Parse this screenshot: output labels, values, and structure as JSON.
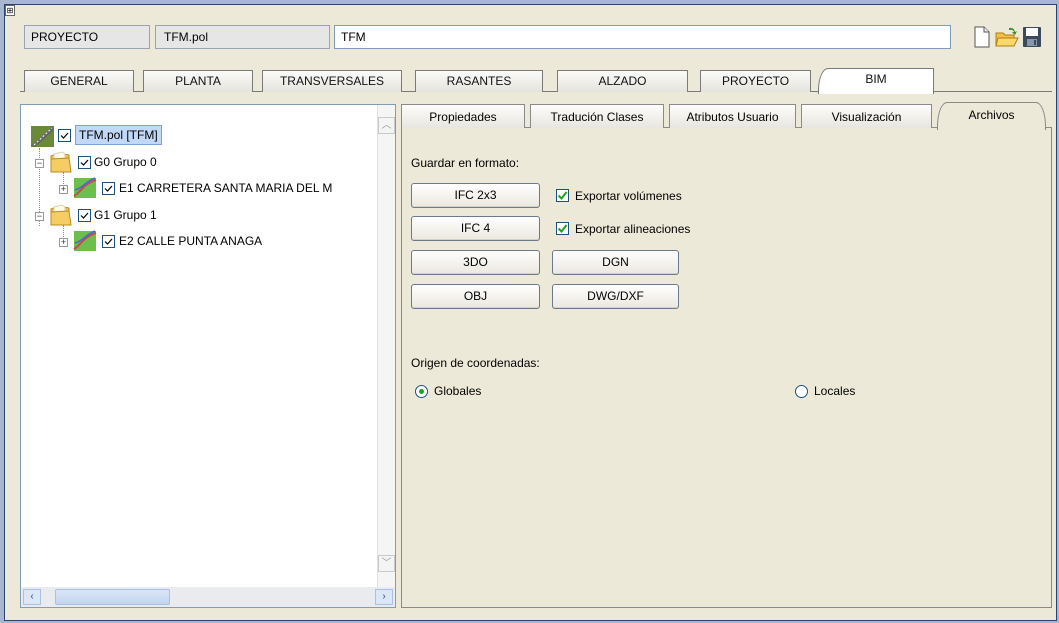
{
  "header": {
    "label": "PROYECTO",
    "file": "TFM.pol",
    "name_value": "TFM"
  },
  "toolbar": {
    "icons": [
      "new-document-icon",
      "open-folder-icon",
      "save-disk-icon"
    ]
  },
  "main_tabs": [
    {
      "label": "GENERAL"
    },
    {
      "label": "PLANTA"
    },
    {
      "label": "TRANSVERSALES"
    },
    {
      "label": "RASANTES"
    },
    {
      "label": "ALZADO"
    },
    {
      "label": "PROYECTO"
    },
    {
      "label": "BIM",
      "active": true
    }
  ],
  "tree": {
    "root": {
      "label": "TFM.pol [TFM]",
      "checked": true,
      "selected": true
    },
    "groups": [
      {
        "label": "G0 Grupo 0",
        "checked": true,
        "child": {
          "label": "E1 CARRETERA SANTA MARIA DEL M",
          "checked": true
        }
      },
      {
        "label": "G1 Grupo 1",
        "checked": true,
        "child": {
          "label": "E2 CALLE PUNTA ANAGA",
          "checked": true
        }
      }
    ]
  },
  "sub_tabs": [
    {
      "label": "Propiedades"
    },
    {
      "label": "Tradución Clases"
    },
    {
      "label": "Atributos Usuario"
    },
    {
      "label": "Visualización"
    },
    {
      "label": "Archivos",
      "active": true
    }
  ],
  "archivos": {
    "save_format_label": "Guardar en formato:",
    "buttons": {
      "ifc2x3": "IFC 2x3",
      "ifc4": "IFC 4",
      "d3o": "3DO",
      "dgn": "DGN",
      "obj": "OBJ",
      "dwg": "DWG/DXF"
    },
    "export_volumes": {
      "label": "Exportar volúmenes",
      "checked": true
    },
    "export_alignments": {
      "label": "Exportar alineaciones",
      "checked": true
    },
    "origin_label": "Origen de coordenadas:",
    "origin_options": [
      {
        "label": "Globales",
        "selected": true
      },
      {
        "label": "Locales",
        "selected": false
      }
    ]
  },
  "colors": {
    "window_bg": "#ece9d8",
    "frame": "#29446e",
    "check_green": "#21a121",
    "selection": "#c2d8f7"
  }
}
